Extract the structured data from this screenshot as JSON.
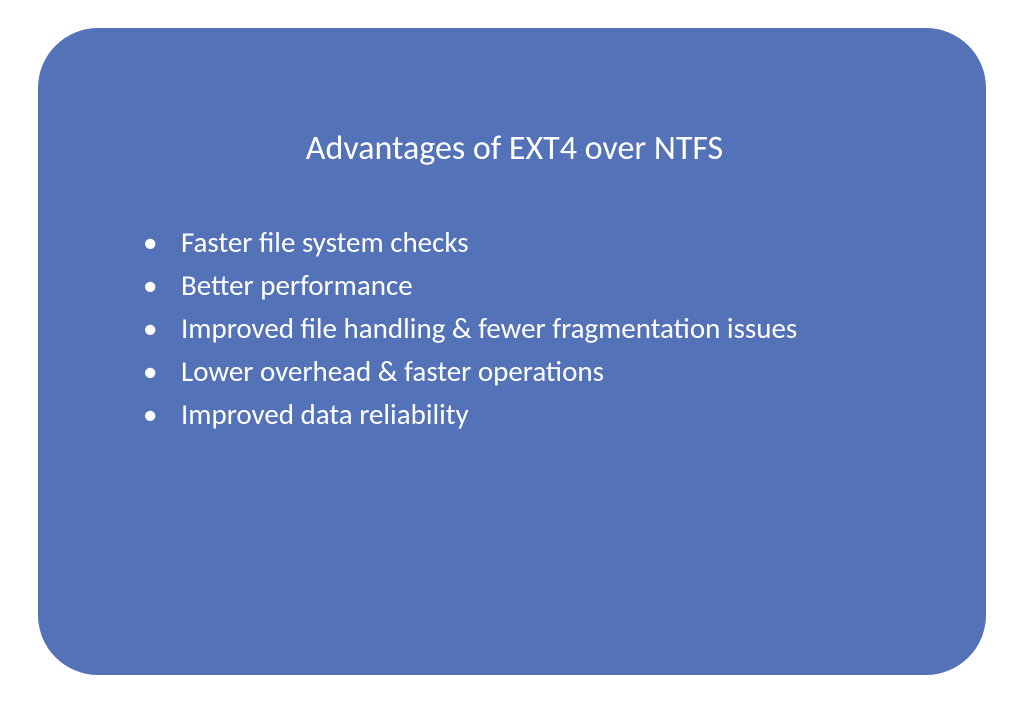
{
  "slide": {
    "title": "Advantages of EXT4 over NTFS",
    "bullets": [
      "Faster file system checks",
      "Better performance",
      "Improved file handling & fewer fragmentation issues",
      "Lower overhead & faster operations",
      "Improved data reliability"
    ]
  }
}
